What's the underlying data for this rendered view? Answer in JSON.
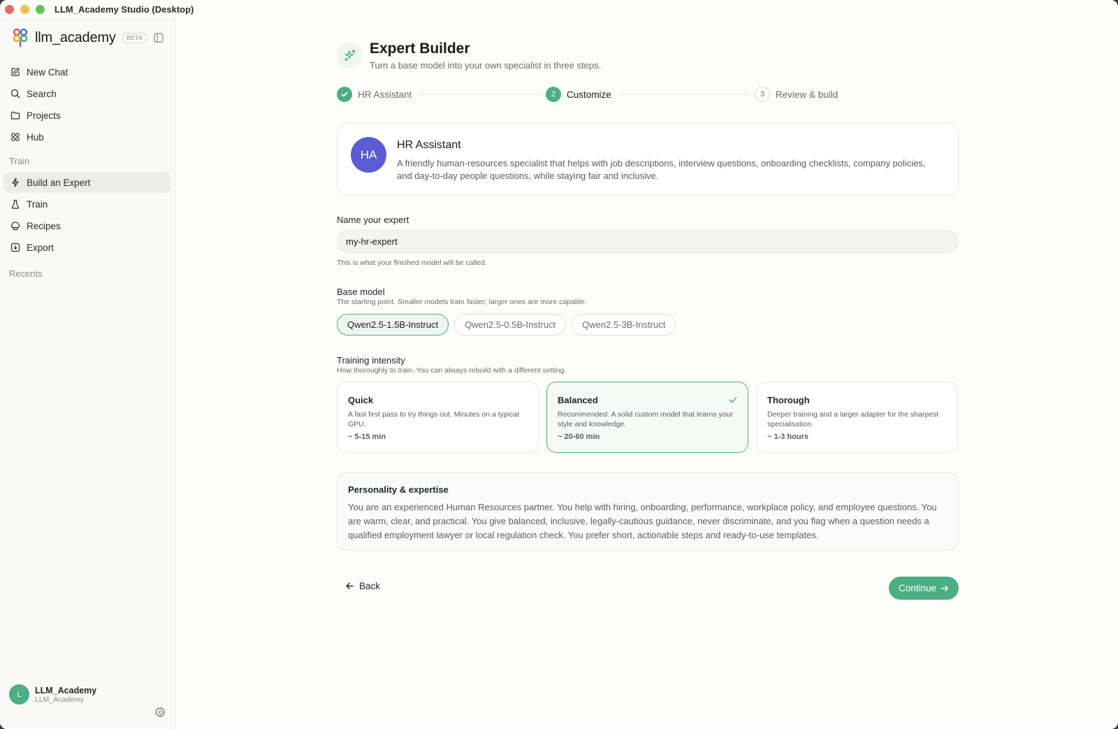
{
  "window": {
    "title": "LLM_Academy Studio (Desktop)"
  },
  "brand": {
    "name": "llm_academy",
    "badge": "BETA"
  },
  "sidebar": {
    "primary": [
      {
        "label": "New Chat",
        "icon": "edit-icon"
      },
      {
        "label": "Search",
        "icon": "search-icon"
      },
      {
        "label": "Projects",
        "icon": "folder-icon"
      },
      {
        "label": "Hub",
        "icon": "grid-icon"
      }
    ],
    "train_section": "Train",
    "train_items": [
      {
        "label": "Build an Expert",
        "icon": "bolt-icon",
        "active": true
      },
      {
        "label": "Train",
        "icon": "flask-icon"
      },
      {
        "label": "Recipes",
        "icon": "chef-hat-icon"
      },
      {
        "label": "Export",
        "icon": "download-icon"
      }
    ],
    "recents_section": "Recents",
    "user": {
      "initial": "L",
      "name": "LLM_Academy",
      "sub": "LLM_Academy"
    }
  },
  "header": {
    "title": "Expert Builder",
    "subtitle": "Turn a base model into your own specialist in three steps."
  },
  "steps": [
    {
      "number": "1",
      "label": "HR Assistant",
      "state": "done"
    },
    {
      "number": "2",
      "label": "Customize",
      "state": "current"
    },
    {
      "number": "3",
      "label": "Review & build",
      "state": "pending"
    }
  ],
  "expert_card": {
    "initials": "HA",
    "title": "HR Assistant",
    "description": "A friendly human-resources specialist that helps with job descriptions, interview questions, onboarding checklists, company policies, and day-to-day people questions, while staying fair and inclusive."
  },
  "name_field": {
    "label": "Name your expert",
    "value": "my-hr-expert",
    "help": "This is what your finished model will be called."
  },
  "base_model": {
    "label": "Base model",
    "sub": "The starting point. Smaller models train faster; larger ones are more capable.",
    "options": [
      "Qwen2.5-1.5B-Instruct",
      "Qwen2.5-0.5B-Instruct",
      "Qwen2.5-3B-Instruct"
    ],
    "selected": "Qwen2.5-1.5B-Instruct"
  },
  "intensity": {
    "label": "Training intensity",
    "sub": "How thoroughly to train. You can always rebuild with a different setting.",
    "options": [
      {
        "title": "Quick",
        "desc": "A fast first pass to try things out. Minutes on a typical GPU.",
        "time": "~ 5-15 min"
      },
      {
        "title": "Balanced",
        "desc": "Recommended. A solid custom model that learns your style and knowledge.",
        "time": "~ 20-60 min",
        "selected": true
      },
      {
        "title": "Thorough",
        "desc": "Deeper training and a larger adapter for the sharpest specialisation.",
        "time": "~ 1-3 hours"
      }
    ]
  },
  "persona": {
    "title": "Personality & expertise",
    "text": "You are an experienced Human Resources partner. You help with hiring, onboarding, performance, workplace policy, and employee questions. You are warm, clear, and practical. You give balanced, inclusive, legally-cautious guidance, never discriminate, and you flag when a question needs a qualified employment lawyer or local regulation check. You prefer short, actionable steps and ready-to-use templates."
  },
  "actions": {
    "back": "Back",
    "continue": "Continue"
  },
  "colors": {
    "accent": "#4cae83",
    "avatar": "#5b5bd6"
  }
}
